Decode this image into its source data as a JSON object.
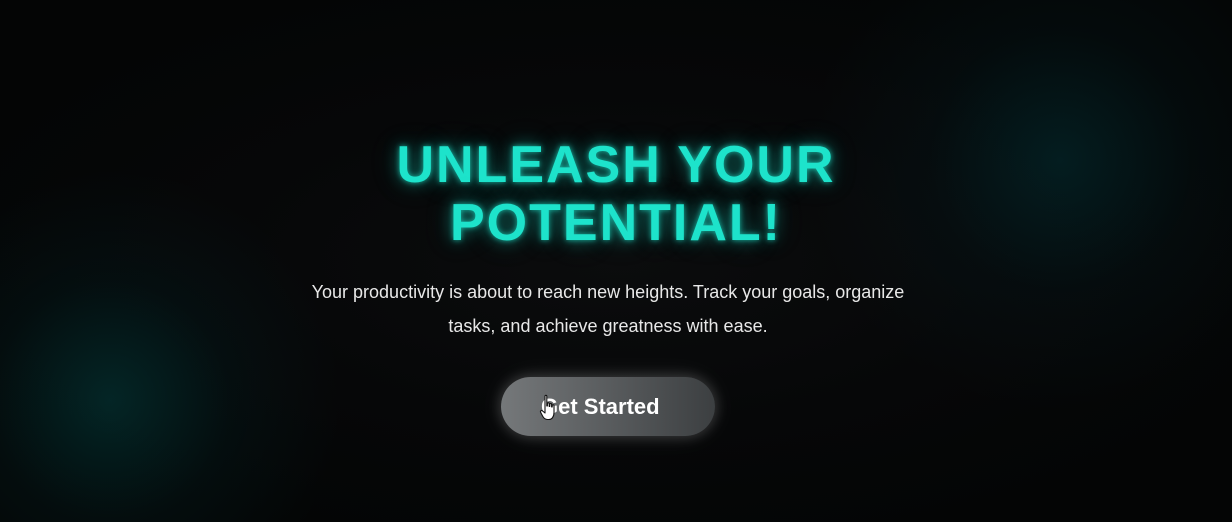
{
  "hero": {
    "headline_line1": "UNLEASH YOUR",
    "headline_line2": "POTENTIAL!",
    "subtext_line1": "Your productivity is about to reach new heights. Track your goals, organize",
    "subtext_line2": "tasks, and achieve greatness with ease.",
    "cta_label": "Get Started"
  },
  "theme": {
    "background": "#050607",
    "accent": "#1de3cb",
    "text": "#e8e8e8",
    "button": "#5c5f61"
  },
  "icons": {
    "cursor": "hand-pointer-icon"
  }
}
